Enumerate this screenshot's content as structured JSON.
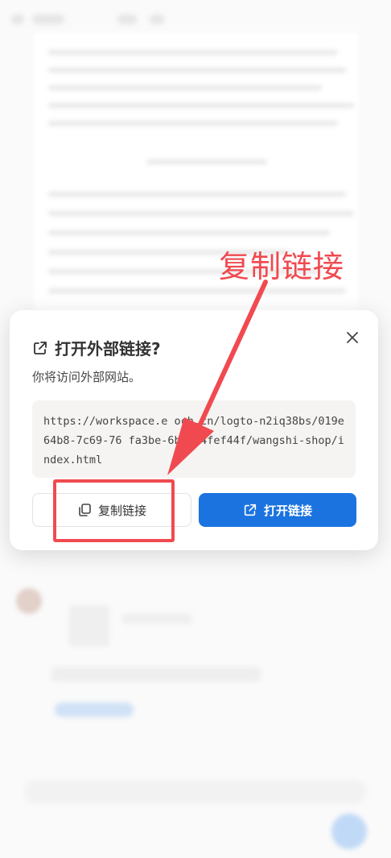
{
  "dialog": {
    "title": "打开外部链接?",
    "description": "你将访问外部网站。",
    "url": "https://workspace.e och.cn/logto-n2iq38bs/019e64b8-7c69-76 fa3be-6bd8f4fef44f/wangshi-shop/index.html",
    "copy_button": "复制链接",
    "open_button": "打开链接"
  },
  "annotation": {
    "label": "复制链接",
    "color": "#f04a50"
  },
  "colors": {
    "primary": "#1b73e0",
    "annotation": "#f04a50"
  }
}
